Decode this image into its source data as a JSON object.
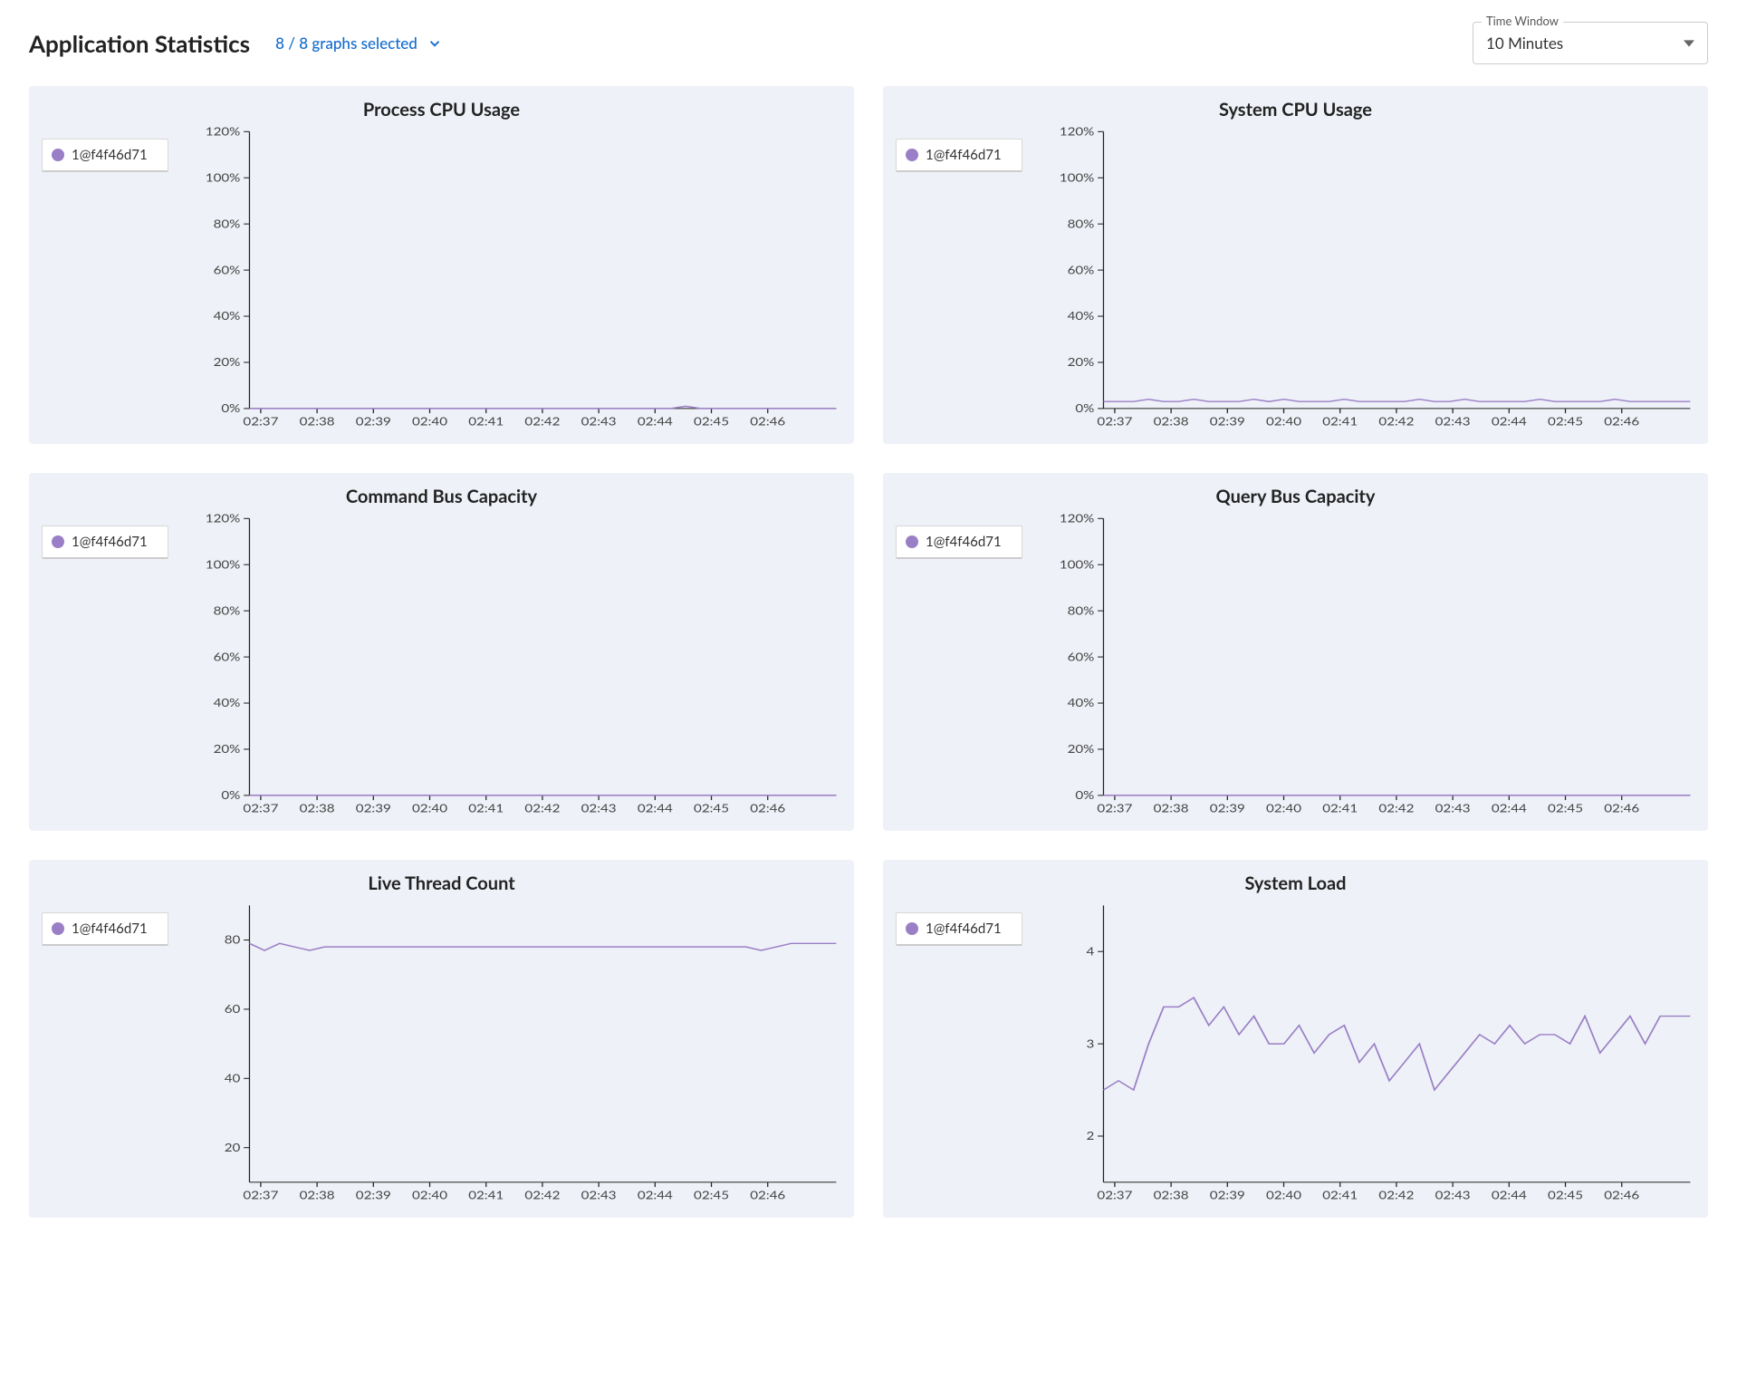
{
  "header": {
    "title": "Application Statistics",
    "graph_selector": "8 / 8 graphs selected",
    "time_window_label": "Time Window",
    "time_window_value": "10 Minutes"
  },
  "legend": {
    "label": "1@f4f46d71"
  },
  "chart_data": [
    {
      "type": "line",
      "title": "Process CPU Usage",
      "xlabel": "",
      "ylabel": "",
      "y_ticks": [
        "0%",
        "20%",
        "40%",
        "60%",
        "80%",
        "100%",
        "120%"
      ],
      "x_ticks": [
        "02:37",
        "02:38",
        "02:39",
        "02:40",
        "02:41",
        "02:42",
        "02:43",
        "02:44",
        "02:45",
        "02:46"
      ],
      "ylim": [
        0,
        120
      ],
      "series": [
        {
          "name": "1@f4f46d71",
          "values": [
            0,
            0,
            0,
            0,
            0,
            0,
            0,
            0,
            0,
            0,
            0,
            0,
            0,
            0,
            0,
            0,
            0,
            0,
            0,
            0,
            0,
            0,
            0,
            0,
            0,
            0,
            0,
            0,
            0,
            1,
            0,
            0,
            0,
            0,
            0,
            0,
            0,
            0,
            0,
            0
          ]
        }
      ],
      "categories_n": 40
    },
    {
      "type": "line",
      "title": "System CPU Usage",
      "xlabel": "",
      "ylabel": "",
      "y_ticks": [
        "0%",
        "20%",
        "40%",
        "60%",
        "80%",
        "100%",
        "120%"
      ],
      "x_ticks": [
        "02:37",
        "02:38",
        "02:39",
        "02:40",
        "02:41",
        "02:42",
        "02:43",
        "02:44",
        "02:45",
        "02:46"
      ],
      "ylim": [
        0,
        120
      ],
      "series": [
        {
          "name": "1@f4f46d71",
          "values": [
            3,
            3,
            3,
            4,
            3,
            3,
            4,
            3,
            3,
            3,
            4,
            3,
            4,
            3,
            3,
            3,
            4,
            3,
            3,
            3,
            3,
            4,
            3,
            3,
            4,
            3,
            3,
            3,
            3,
            4,
            3,
            3,
            3,
            3,
            4,
            3,
            3,
            3,
            3,
            3
          ]
        }
      ],
      "categories_n": 40
    },
    {
      "type": "line",
      "title": "Command Bus Capacity",
      "xlabel": "",
      "ylabel": "",
      "y_ticks": [
        "0%",
        "20%",
        "40%",
        "60%",
        "80%",
        "100%",
        "120%"
      ],
      "x_ticks": [
        "02:37",
        "02:38",
        "02:39",
        "02:40",
        "02:41",
        "02:42",
        "02:43",
        "02:44",
        "02:45",
        "02:46"
      ],
      "ylim": [
        0,
        120
      ],
      "series": [
        {
          "name": "1@f4f46d71",
          "values": [
            0,
            0,
            0,
            0,
            0,
            0,
            0,
            0,
            0,
            0,
            0,
            0,
            0,
            0,
            0,
            0,
            0,
            0,
            0,
            0,
            0,
            0,
            0,
            0,
            0,
            0,
            0,
            0,
            0,
            0,
            0,
            0,
            0,
            0,
            0,
            0,
            0,
            0,
            0,
            0
          ]
        }
      ],
      "categories_n": 40
    },
    {
      "type": "line",
      "title": "Query Bus Capacity",
      "xlabel": "",
      "ylabel": "",
      "y_ticks": [
        "0%",
        "20%",
        "40%",
        "60%",
        "80%",
        "100%",
        "120%"
      ],
      "x_ticks": [
        "02:37",
        "02:38",
        "02:39",
        "02:40",
        "02:41",
        "02:42",
        "02:43",
        "02:44",
        "02:45",
        "02:46"
      ],
      "ylim": [
        0,
        120
      ],
      "series": [
        {
          "name": "1@f4f46d71",
          "values": [
            0,
            0,
            0,
            0,
            0,
            0,
            0,
            0,
            0,
            0,
            0,
            0,
            0,
            0,
            0,
            0,
            0,
            0,
            0,
            0,
            0,
            0,
            0,
            0,
            0,
            0,
            0,
            0,
            0,
            0,
            0,
            0,
            0,
            0,
            0,
            0,
            0,
            0,
            0,
            0
          ]
        }
      ],
      "categories_n": 40
    },
    {
      "type": "line",
      "title": "Live Thread Count",
      "xlabel": "",
      "ylabel": "",
      "y_ticks": [
        "20",
        "40",
        "60",
        "80"
      ],
      "x_ticks": [
        "02:37",
        "02:38",
        "02:39",
        "02:40",
        "02:41",
        "02:42",
        "02:43",
        "02:44",
        "02:45",
        "02:46"
      ],
      "ylim": [
        10,
        90
      ],
      "series": [
        {
          "name": "1@f4f46d71",
          "values": [
            79,
            77,
            79,
            78,
            77,
            78,
            78,
            78,
            78,
            78,
            78,
            78,
            78,
            78,
            78,
            78,
            78,
            78,
            78,
            78,
            78,
            78,
            78,
            78,
            78,
            78,
            78,
            78,
            78,
            78,
            78,
            78,
            78,
            78,
            77,
            78,
            79,
            79,
            79,
            79
          ]
        }
      ],
      "categories_n": 40
    },
    {
      "type": "line",
      "title": "System Load",
      "xlabel": "",
      "ylabel": "",
      "y_ticks": [
        "2",
        "3",
        "4"
      ],
      "x_ticks": [
        "02:37",
        "02:38",
        "02:39",
        "02:40",
        "02:41",
        "02:42",
        "02:43",
        "02:44",
        "02:45",
        "02:46"
      ],
      "ylim": [
        1.5,
        4.5
      ],
      "series": [
        {
          "name": "1@f4f46d71",
          "values": [
            2.5,
            2.6,
            2.5,
            3.0,
            3.4,
            3.4,
            3.5,
            3.2,
            3.4,
            3.1,
            3.3,
            3.0,
            3.0,
            3.2,
            2.9,
            3.1,
            3.2,
            2.8,
            3.0,
            2.6,
            2.8,
            3.0,
            2.5,
            2.7,
            2.9,
            3.1,
            3.0,
            3.2,
            3.0,
            3.1,
            3.1,
            3.0,
            3.3,
            2.9,
            3.1,
            3.3,
            3.0,
            3.3,
            3.3,
            3.3
          ]
        }
      ],
      "categories_n": 40
    }
  ]
}
